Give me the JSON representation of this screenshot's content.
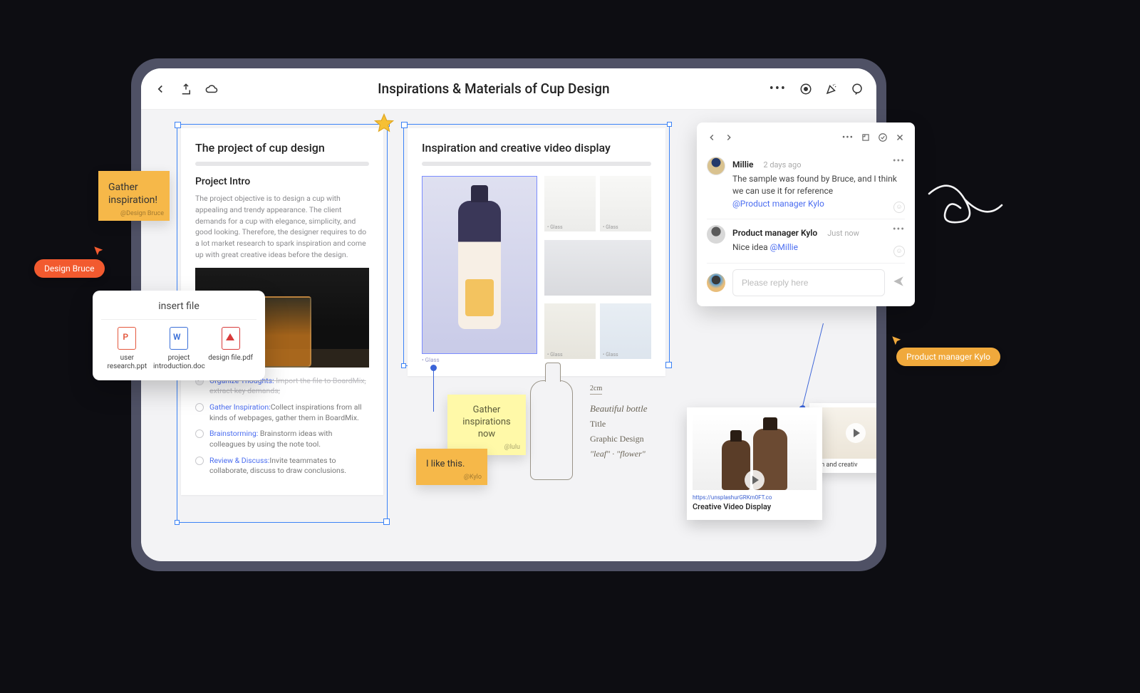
{
  "header": {
    "title": "Inspirations & Materials of Cup Design"
  },
  "card1": {
    "title": "The project of cup design",
    "subtitle": "Project Intro",
    "body": "The project objective is to design a cup with appealing and trendy appearance. The client demands for a cup with elegance, simplicity, and good looking. Therefore, the designer requires to do a lot market research to spark inspiration and come up with great creative ideas before the design.",
    "checklist": [
      {
        "done": true,
        "link": "Organize Thoughts:",
        "rest": "Import the file to BoardMix, extract key demands;"
      },
      {
        "done": false,
        "link": "Gather Inspiration:",
        "rest": "Collect inspirations from all kinds of webpages, gather them in BoardMix."
      },
      {
        "done": false,
        "link": "Brainstorming:",
        "rest": "Brainstorm ideas with colleagues by using the note tool."
      },
      {
        "done": false,
        "link": "Review & Discuss:",
        "rest": "Invite teammates to collaborate, discuss to draw conclusions."
      }
    ]
  },
  "card2": {
    "title": "Inspiration and creative video display",
    "main_caption": "• Glass",
    "thumbs": [
      "• Glass",
      "• Glass",
      "• Glass",
      "• Glass"
    ]
  },
  "sticky1": {
    "text": "Gather inspiration!",
    "sig": "@Design Bruce"
  },
  "sticky2": {
    "text": "Gather inspirations now",
    "sig": "@lulu"
  },
  "sticky3": {
    "text": "I like this.",
    "sig": "@Kylo"
  },
  "cursors": {
    "bruce": "Design Bruce",
    "kylo": "Product manager Kylo"
  },
  "insert_file": {
    "title": "insert file",
    "files": [
      {
        "name": "user research.ppt"
      },
      {
        "name": "project introduction.doc"
      },
      {
        "name": "design file.pdf"
      }
    ]
  },
  "comments": {
    "items": [
      {
        "user": "Millie",
        "time": "2 days ago",
        "text": "The sample was found by Bruce, and I think we can use it for reference",
        "mention": "@Product manager Kylo"
      },
      {
        "user": "Product manager Kylo",
        "time": "Just now",
        "text": "Nice idea ",
        "mention": "@Millie"
      }
    ],
    "placeholder": "Please reply here"
  },
  "video": {
    "url": "https://unsplashurGRKm0FT.co",
    "title": "Creative Video Display",
    "small_caption": "tion and creativ"
  },
  "sketch": {
    "dim": "2cm",
    "l1": "Beautiful bottle",
    "l2": "Title",
    "l3": "Graphic Design",
    "l4": "\"leaf\" · \"flower\""
  }
}
